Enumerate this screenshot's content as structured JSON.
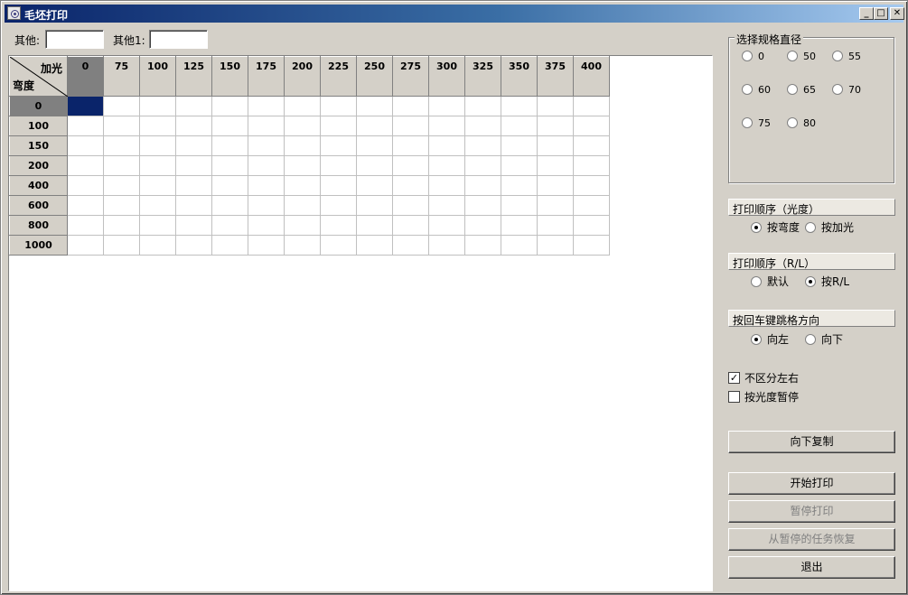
{
  "window": {
    "title": "毛坯打印",
    "controls": [
      "_",
      "□",
      "✕"
    ]
  },
  "fields": {
    "other_label": "其他:",
    "other_value": "",
    "other1_label": "其他1:",
    "other1_value": ""
  },
  "grid": {
    "corner_top": "加光",
    "corner_bottom": "弯度",
    "columns": [
      "0",
      "75",
      "100",
      "125",
      "150",
      "175",
      "200",
      "225",
      "250",
      "275",
      "300",
      "325",
      "350",
      "375",
      "400"
    ],
    "rows": [
      "0",
      "100",
      "150",
      "200",
      "400",
      "600",
      "800",
      "1000"
    ],
    "selected_row": 0,
    "selected_col": 0
  },
  "diameter_group": {
    "title": "选择规格直径",
    "options": [
      "0",
      "50",
      "55",
      "60",
      "65",
      "70",
      "75",
      "80"
    ],
    "selected": null
  },
  "print_order_power": {
    "title": "打印顺序（光度）",
    "options": [
      "按弯度",
      "按加光"
    ],
    "selected": 0
  },
  "print_order_rl": {
    "title": "打印顺序（R/L）",
    "options": [
      "默认",
      "按R/L"
    ],
    "selected": 1
  },
  "enter_direction": {
    "title": "按回车键跳格方向",
    "options": [
      "向左",
      "向下"
    ],
    "selected": 0
  },
  "checkboxes": [
    {
      "label": "不区分左右",
      "checked": true
    },
    {
      "label": "按光度暂停",
      "checked": false
    }
  ],
  "buttons": {
    "copy_down": "向下复制",
    "start_print": "开始打印",
    "pause_print": "暂停打印",
    "resume_task": "从暂停的任务恢复",
    "exit": "退出"
  },
  "colors": {
    "selection": "#0a246a",
    "title_gradient_start": "#0a246a",
    "title_gradient_end": "#a6caf0",
    "face": "#d4d0c8"
  }
}
